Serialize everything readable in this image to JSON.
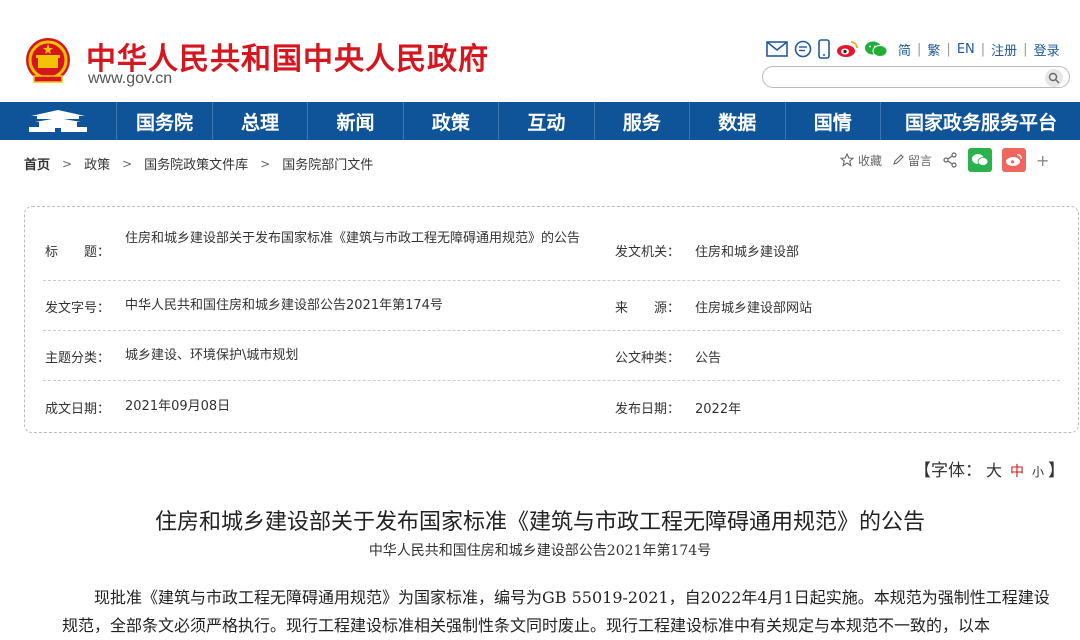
{
  "header": {
    "site_name": "中华人民共和国中央人民政府",
    "site_url": "www.gov.cn",
    "top_links": [
      "简",
      "繁",
      "EN",
      "注册",
      "登录"
    ],
    "search_placeholder": ""
  },
  "nav": {
    "items": [
      "国务院",
      "总理",
      "新闻",
      "政策",
      "互动",
      "服务",
      "数据",
      "国情"
    ],
    "last_item": "国家政务服务平台"
  },
  "breadcrumb": {
    "items": [
      "首页",
      "政策",
      "国务院政策文件库",
      "国务院部门文件"
    ]
  },
  "tools": {
    "favorite": "收藏",
    "comment": "留言",
    "more": "+"
  },
  "info": {
    "title_label": "标　　题：",
    "title_value": "住房和城乡建设部关于发布国家标准《建筑与市政工程无障碍通用规范》的公告",
    "issuer_label": "发文机关：",
    "issuer_value": "住房和城乡建设部",
    "docno_label": "发文字号：",
    "docno_value": "中华人民共和国住房和城乡建设部公告2021年第174号",
    "source_label": "来　　源：",
    "source_value": "住房城乡建设部网站",
    "topic_label": "主题分类：",
    "topic_value": "城乡建设、环境保护\\城市规划",
    "doctype_label": "公文种类：",
    "doctype_value": "公告",
    "written_label": "成文日期：",
    "written_value": "2021年09月08日",
    "published_label": "发布日期：",
    "published_value": "2022年"
  },
  "fontsize": {
    "prefix": "【字体：",
    "big": "大",
    "mid": "中",
    "small": "小",
    "suffix": "】"
  },
  "article": {
    "title": "住房和城乡建设部关于发布国家标准《建筑与市政工程无障碍通用规范》的公告",
    "subtitle": "中华人民共和国住房和城乡建设部公告2021年第174号",
    "body": "现批准《建筑与市政工程无障碍通用规范》为国家标准，编号为GB 55019-2021，自2022年4月1日起实施。本规范为强制性工程建设规范，全部条文必须严格执行。现行工程建设标准相关强制性条文同时废止。现行工程建设标准中有关规定与本规范不一致的，以本"
  },
  "colors": {
    "brand_red": "#d5161e",
    "nav_blue": "#0f5399"
  }
}
